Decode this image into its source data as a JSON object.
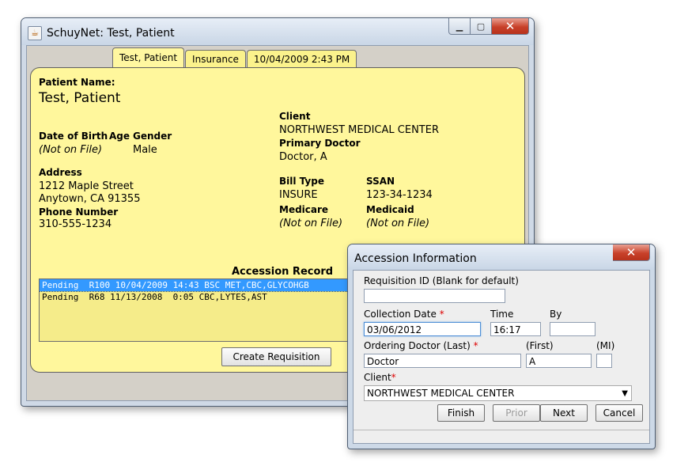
{
  "main_window": {
    "title": "SchuyNet:  Test, Patient",
    "icon": "java-cup-icon",
    "tabs": [
      {
        "label": "Test, Patient",
        "active": true
      },
      {
        "label": "Insurance",
        "active": false
      },
      {
        "label": "10/04/2009  2:43 PM",
        "active": false
      }
    ],
    "patient": {
      "name_label": "Patient Name:",
      "name": "Test, Patient",
      "dob_label": "Date of Birth",
      "dob": "(Not on File)",
      "age_label": "Age",
      "gender_label": "Gender",
      "gender": "Male",
      "address_label": "Address",
      "address_line1": "1212 Maple Street",
      "address_line2": "Anytown, CA 91355",
      "phone_label": "Phone Number",
      "phone": "310-555-1234",
      "client_label": "Client",
      "client": "NORTHWEST MEDICAL CENTER",
      "primary_doctor_label": "Primary Doctor",
      "primary_doctor": "Doctor, A",
      "bill_type_label": "Bill Type",
      "bill_type": "INSURE",
      "ssan_label": "SSAN",
      "ssan": "123-34-1234",
      "medicare_label": "Medicare",
      "medicare": "(Not on File)",
      "medicaid_label": "Medicaid",
      "medicaid": "(Not on File)"
    },
    "accession": {
      "title": "Accession Record",
      "rows": [
        {
          "text": "Pending  R100 10/04/2009 14:43 BSC MET,CBC,GLYCOHGB",
          "selected": true
        },
        {
          "text": "Pending  R68 11/13/2008  0:05 CBC,LYTES,AST",
          "selected": false
        }
      ],
      "create_button": "Create Requisition"
    }
  },
  "dialog": {
    "title": "Accession Information",
    "requisition_label": "Requisition ID (Blank for default)",
    "requisition_value": "",
    "collection_date_label": "Collection Date",
    "collection_date": "03/06/2012",
    "time_label": "Time",
    "time": "16:17",
    "by_label": "By",
    "by": "",
    "doctor_last_label": "Ordering Doctor (Last)",
    "doctor_last": "Doctor",
    "first_label": "(First)",
    "first": "A",
    "mi_label": "(MI)",
    "mi": "",
    "client_label": "Client",
    "client": "NORTHWEST MEDICAL CENTER",
    "required_mark": "*",
    "buttons": {
      "finish": "Finish",
      "prior": "Prior",
      "next": "Next",
      "cancel": "Cancel"
    }
  },
  "colors": {
    "panel_yellow": "#fff79c",
    "selection_blue": "#3399ff",
    "close_red": "#c8412a",
    "required_red": "#dd0000"
  }
}
